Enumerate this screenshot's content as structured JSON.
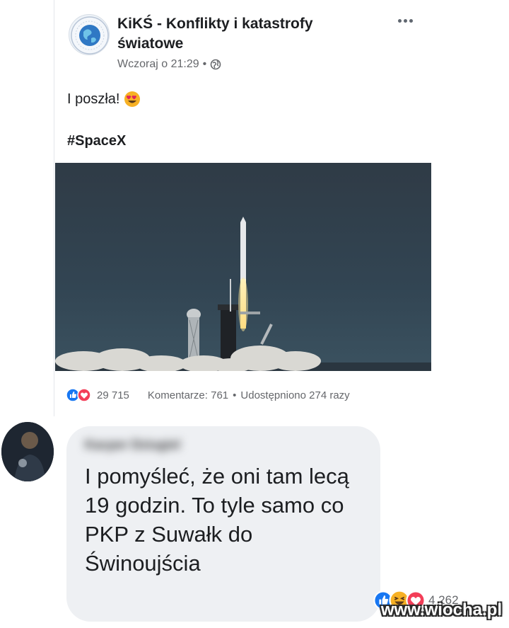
{
  "post": {
    "page_name": "KiKŚ - Konflikty i katastrofy światowe",
    "timestamp": "Wczoraj o 21:29",
    "meta_separator": "•",
    "text": "I poszła!",
    "hashtag": "#SpaceX",
    "icons": {
      "privacy": "globe-icon",
      "more": "more-options-icon",
      "emoji": "heart-eyes-emoji"
    },
    "stats": {
      "reactions_count": "29 715",
      "comments": "Komentarze: 761",
      "separator": "•",
      "shares": "Udostępniono 274 razy",
      "reaction_icons": [
        "like-icon",
        "love-icon"
      ]
    }
  },
  "comment": {
    "author": "Kacper Dziugiel",
    "text": "I pomyśleć, że oni tam lecą 19 godzin. To tyle samo co PKP z Suwałk do Świnoujścia",
    "reactions_count": "4 262",
    "reaction_icons": [
      "like-icon",
      "haha-icon",
      "love-icon"
    ]
  },
  "watermark": "www.wiocha.pl",
  "colors": {
    "like_blue": "#1877f2",
    "love_red": "#f33e58",
    "haha_yellow": "#f7b125",
    "bubble_gray": "#eef0f3",
    "meta_gray": "#65676b"
  }
}
